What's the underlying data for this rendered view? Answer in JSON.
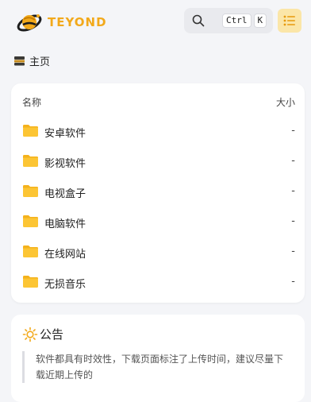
{
  "header": {
    "brand": "TEYOND",
    "search_shortcut": [
      "Ctrl",
      "K"
    ],
    "accent": "#f2a91b"
  },
  "breadcrumb": {
    "icon": "drive-icon",
    "label": "主页"
  },
  "file_list": {
    "col_name": "名称",
    "col_size": "大小",
    "rows": [
      {
        "name": "安卓软件",
        "size": "-"
      },
      {
        "name": "影视软件",
        "size": "-"
      },
      {
        "name": "电视盒子",
        "size": "-"
      },
      {
        "name": "电脑软件",
        "size": "-"
      },
      {
        "name": "在线网站",
        "size": "-"
      },
      {
        "name": "无损音乐",
        "size": "-"
      }
    ]
  },
  "notice": {
    "icon": "sun-icon",
    "title": "公告",
    "text": "软件都具有时效性，下载页面标注了上传时间，建议尽量下载近期上传的"
  }
}
